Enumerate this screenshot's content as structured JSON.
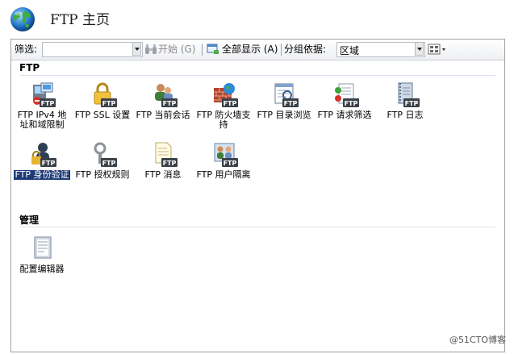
{
  "header": {
    "title": "FTP  主页"
  },
  "toolbar": {
    "filter_label": "筛选:",
    "start_label": "开始 (G)",
    "show_all_label": "全部显示 (A)",
    "group_by_label": "分组依据:",
    "group_by_value": "区域"
  },
  "sections": {
    "ftp": {
      "title": "FTP",
      "items": [
        {
          "label": "FTP IPv4 地址和域限制"
        },
        {
          "label": "FTP SSL 设置"
        },
        {
          "label": "FTP 当前会话"
        },
        {
          "label": "FTP 防火墙支持"
        },
        {
          "label": "FTP 目录浏览"
        },
        {
          "label": "FTP 请求筛选"
        },
        {
          "label": "FTP 日志"
        },
        {
          "label": "FTP 身份验证"
        },
        {
          "label": "FTP 授权规则"
        },
        {
          "label": "FTP 消息"
        },
        {
          "label": "FTP 用户隔离"
        }
      ]
    },
    "manage": {
      "title": "管理",
      "items": [
        {
          "label": "配置编辑器"
        }
      ]
    }
  },
  "icons": {
    "badge_text": "FTP"
  },
  "watermark": "@51CTO博客"
}
